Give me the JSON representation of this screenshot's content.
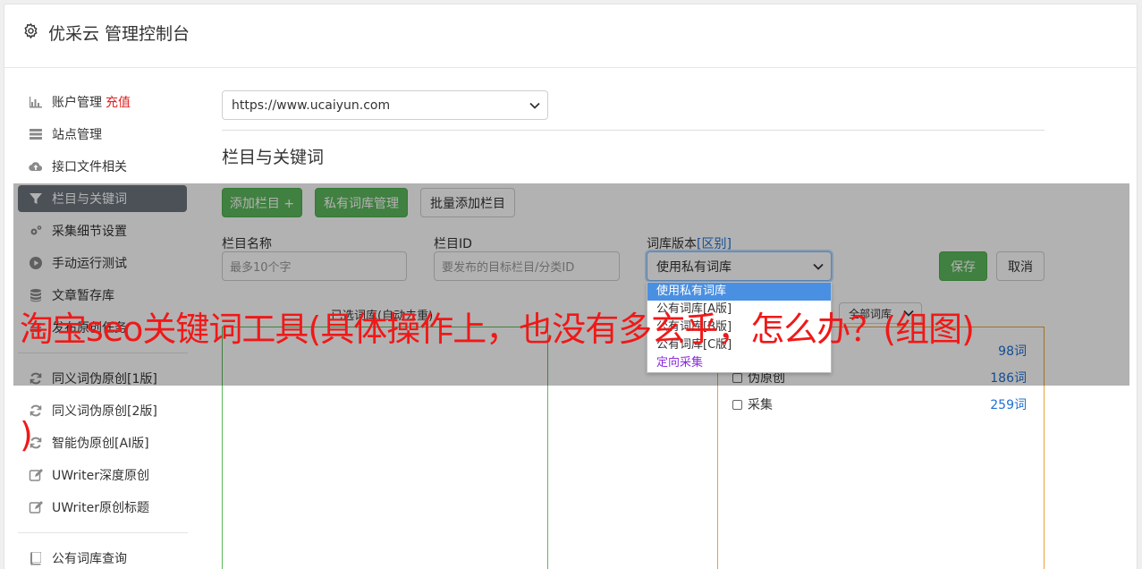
{
  "header": {
    "title": "优采云 管理控制台",
    "icon": "gear-icon"
  },
  "sidebar": {
    "items": [
      {
        "label": "账户管理",
        "badge": "充值",
        "icon": "bar-chart-icon"
      },
      {
        "label": "站点管理",
        "icon": "server-icon"
      },
      {
        "label": "接口文件相关",
        "icon": "cloud-upload-icon"
      },
      {
        "label": "栏目与关键词",
        "icon": "filter-icon",
        "active": true
      },
      {
        "label": "采集细节设置",
        "icon": "cogs-icon"
      },
      {
        "label": "手动运行测试",
        "icon": "play-circle-icon"
      },
      {
        "label": "文章暂存库",
        "icon": "database-icon"
      },
      {
        "label": "发布原创任务",
        "icon": "list-icon"
      },
      {
        "label": "同义词伪原创[1版]",
        "icon": "refresh-icon"
      },
      {
        "label": "同义词伪原创[2版]",
        "icon": "refresh-icon"
      },
      {
        "label": "智能伪原创[AI版]",
        "icon": "refresh-icon"
      },
      {
        "label": "UWriter深度原创",
        "icon": "edit-icon"
      },
      {
        "label": "UWriter原创标题",
        "icon": "edit-icon"
      },
      {
        "label": "公有词库查询",
        "icon": "book-icon"
      }
    ]
  },
  "main": {
    "site_select": "https://www.ucaiyun.com",
    "section_title": "栏目与关键词",
    "buttons": {
      "add_column": "添加栏目 +",
      "private_lib": "私有词库管理",
      "batch_add": "批量添加栏目",
      "save": "保存",
      "cancel": "取消"
    },
    "form": {
      "name_label": "栏目名称",
      "name_placeholder": "最多10个字",
      "id_label": "栏目ID",
      "id_placeholder": "要发布的目标栏目/分类ID",
      "version_label": "词库版本",
      "version_link": "[区别]",
      "version_value": "使用私有词库",
      "version_options": [
        "使用私有词库",
        "公有词库[A版]",
        "公有词库[B版]",
        "公有词库[C版]",
        "定向采集"
      ]
    },
    "left_panel_title": "已选词库(自动去重)",
    "right_filter": "全部词库",
    "right_items": [
      {
        "label": "",
        "count": "98词"
      },
      {
        "label": "伪原创",
        "count": "186词"
      },
      {
        "label": "采集",
        "count": "259词"
      }
    ]
  },
  "headline": {
    "line1": "淘宝seo关键词工具(具体操作上，也没有多玄乎，怎么办？(组图)",
    "line2": ")"
  }
}
